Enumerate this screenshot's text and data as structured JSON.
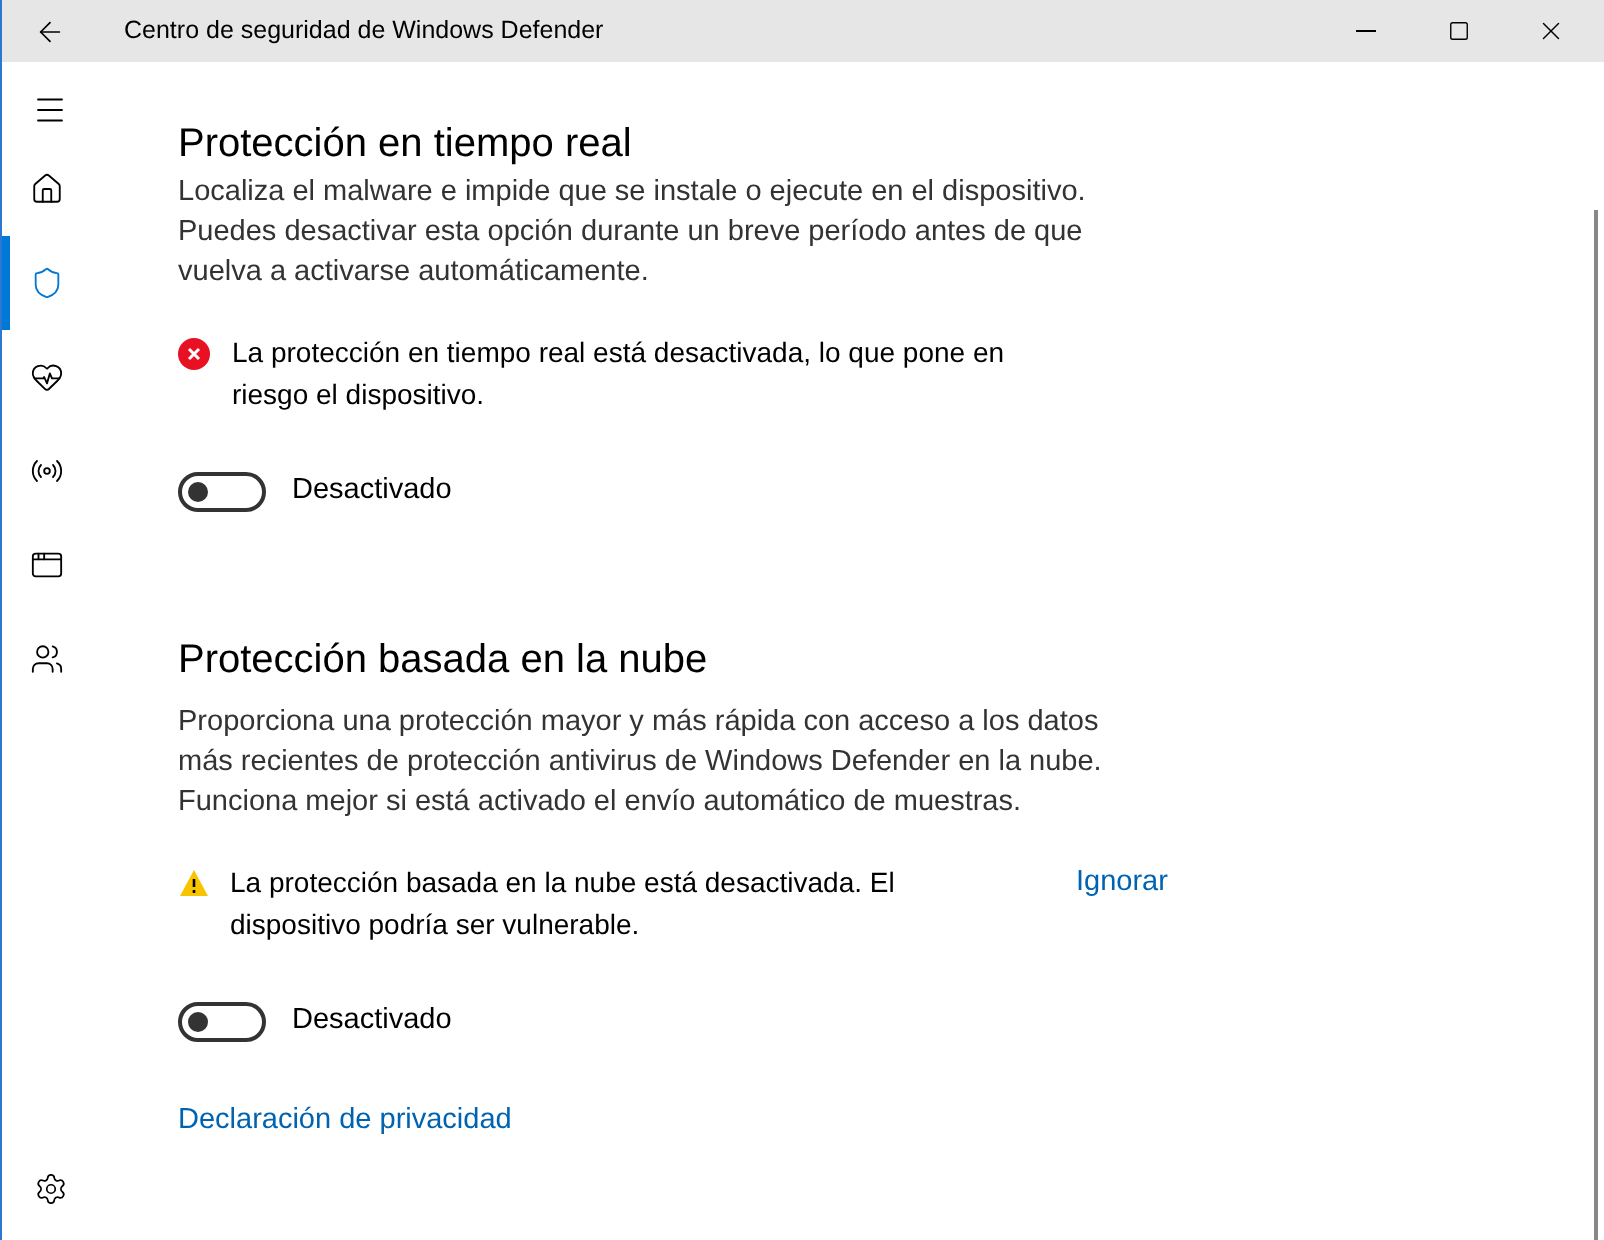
{
  "window": {
    "title": "Centro de seguridad de Windows Defender"
  },
  "sidebar": {
    "items": [
      {
        "kind": "home",
        "selected": false
      },
      {
        "kind": "shield",
        "selected": true
      },
      {
        "kind": "health",
        "selected": false
      },
      {
        "kind": "network",
        "selected": false
      },
      {
        "kind": "app",
        "selected": false
      },
      {
        "kind": "family",
        "selected": false
      }
    ]
  },
  "sections": [
    {
      "title": "Protección en tiempo real",
      "description": "Localiza el malware e impide que se instale o ejecute en el dispositivo. Puedes desactivar esta opción durante un breve período antes de que vuelva a activarse automáticamente.",
      "alert": {
        "kind": "error",
        "text": "La protección en tiempo real está desactivada, lo que pone en riesgo el dispositivo."
      },
      "toggle": {
        "on": false,
        "label": "Desactivado"
      }
    },
    {
      "title": "Protección basada en la nube",
      "description": "Proporciona una protección mayor y más rápida con acceso a los datos más recientes de protección antivirus de Windows Defender en la nube. Funciona mejor si está activado el envío automático de muestras.",
      "alert": {
        "kind": "warning",
        "text": "La protección basada en la nube está desactivada. El dispositivo podría ser vulnerable.",
        "action": "Ignorar"
      },
      "toggle": {
        "on": false,
        "label": "Desactivado"
      }
    }
  ],
  "privacy_link": "Declaración de privacidad"
}
